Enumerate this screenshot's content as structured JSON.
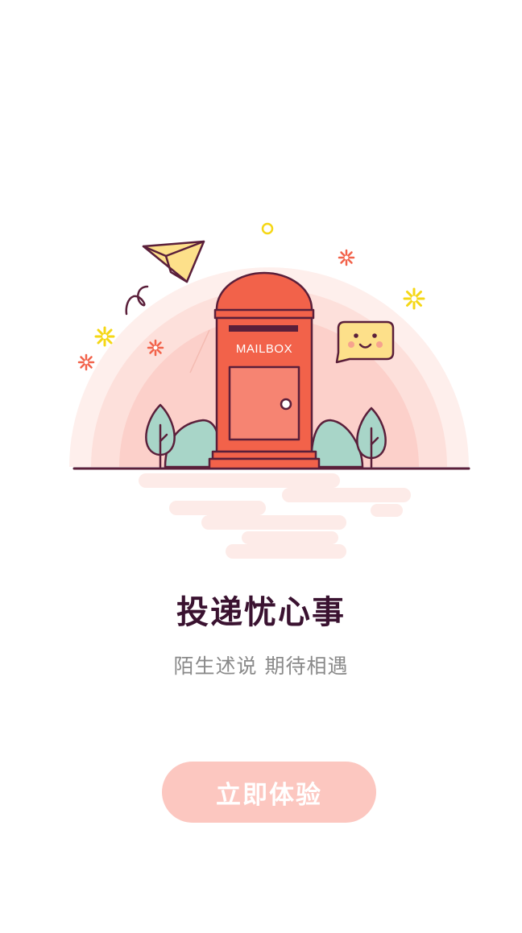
{
  "illustration": {
    "mailbox_label": "MAILBOX"
  },
  "intro": {
    "title": "投递忧心事",
    "subtitle": "陌生述说 期待相遇"
  },
  "cta": {
    "label": "立即体验"
  },
  "colors": {
    "primary": "#f2624a",
    "primary_light": "#fcc7c0",
    "outline": "#5a1f3a",
    "title_text": "#3a1230",
    "subtitle_text": "#8a8a8a",
    "bush": "#a8d5c8",
    "star": "#f5d716",
    "speech_bubble": "#fde08a"
  }
}
